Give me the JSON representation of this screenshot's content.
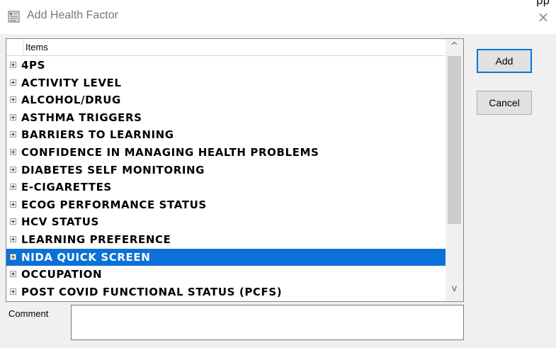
{
  "window": {
    "title": "Add Health Factor",
    "corner_text": "pp",
    "close_glyph": "×",
    "icon": "document-icon"
  },
  "list": {
    "header": "Items",
    "items": [
      {
        "label": "4PS",
        "selected": false
      },
      {
        "label": "ACTIVITY LEVEL",
        "selected": false
      },
      {
        "label": "ALCOHOL/DRUG",
        "selected": false
      },
      {
        "label": "ASTHMA TRIGGERS",
        "selected": false
      },
      {
        "label": "BARRIERS TO LEARNING",
        "selected": false
      },
      {
        "label": "CONFIDENCE IN MANAGING HEALTH PROBLEMS",
        "selected": false
      },
      {
        "label": "DIABETES SELF MONITORING",
        "selected": false
      },
      {
        "label": "E-CIGARETTES",
        "selected": false
      },
      {
        "label": "ECOG PERFORMANCE STATUS",
        "selected": false
      },
      {
        "label": "HCV STATUS",
        "selected": false
      },
      {
        "label": "LEARNING PREFERENCE",
        "selected": false
      },
      {
        "label": "NIDA QUICK SCREEN",
        "selected": true
      },
      {
        "label": "OCCUPATION",
        "selected": false
      },
      {
        "label": "POST COVID FUNCTIONAL STATUS (PCFS)",
        "selected": false
      }
    ],
    "scroll_up_glyph": "^",
    "scroll_down_glyph": "v"
  },
  "buttons": {
    "add": "Add",
    "cancel": "Cancel"
  },
  "comment": {
    "label": "Comment",
    "value": ""
  },
  "colors": {
    "selection": "#0b71d8",
    "default_button_border": "#0078d7"
  }
}
